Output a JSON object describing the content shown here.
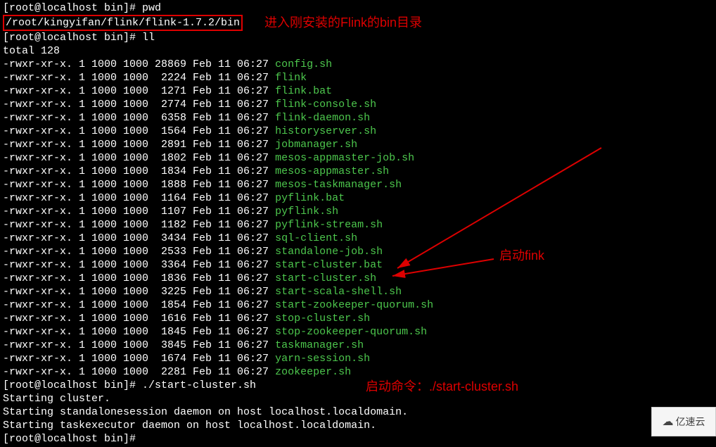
{
  "prompt1": "[root@localhost bin]# pwd",
  "path": "/root/kingyifan/flink/flink-1.7.2/bin",
  "prompt2": "[root@localhost bin]# ll",
  "total": "total 128",
  "perm": "-rwxr-xr-x.",
  "link": "1",
  "own": "1000",
  "grp": "1000",
  "date_prefix": "Feb 11 06:27",
  "files": [
    {
      "size": "28869",
      "name": "config.sh"
    },
    {
      "size": " 2224",
      "name": "flink"
    },
    {
      "size": " 1271",
      "name": "flink.bat"
    },
    {
      "size": " 2774",
      "name": "flink-console.sh"
    },
    {
      "size": " 6358",
      "name": "flink-daemon.sh"
    },
    {
      "size": " 1564",
      "name": "historyserver.sh"
    },
    {
      "size": " 2891",
      "name": "jobmanager.sh"
    },
    {
      "size": " 1802",
      "name": "mesos-appmaster-job.sh"
    },
    {
      "size": " 1834",
      "name": "mesos-appmaster.sh"
    },
    {
      "size": " 1888",
      "name": "mesos-taskmanager.sh"
    },
    {
      "size": " 1164",
      "name": "pyflink.bat"
    },
    {
      "size": " 1107",
      "name": "pyflink.sh"
    },
    {
      "size": " 1182",
      "name": "pyflink-stream.sh"
    },
    {
      "size": " 3434",
      "name": "sql-client.sh"
    },
    {
      "size": " 2533",
      "name": "standalone-job.sh"
    },
    {
      "size": " 3364",
      "name": "start-cluster.bat"
    },
    {
      "size": " 1836",
      "name": "start-cluster.sh"
    },
    {
      "size": " 3225",
      "name": "start-scala-shell.sh"
    },
    {
      "size": " 1854",
      "name": "start-zookeeper-quorum.sh"
    },
    {
      "size": " 1616",
      "name": "stop-cluster.sh"
    },
    {
      "size": " 1845",
      "name": "stop-zookeeper-quorum.sh"
    },
    {
      "size": " 3845",
      "name": "taskmanager.sh"
    },
    {
      "size": " 1674",
      "name": "yarn-session.sh"
    },
    {
      "size": " 2281",
      "name": "zookeeper.sh"
    }
  ],
  "prompt3": "[root@localhost bin]# ./start-cluster.sh",
  "out_lines": [
    "Starting cluster.",
    "Starting standalonesession daemon on host localhost.localdomain.",
    "Starting taskexecutor daemon on host localhost.localdomain."
  ],
  "prompt4": "[root@localhost bin]# ",
  "annotations": {
    "a1": "进入刚安装的Flink的bin目录",
    "a2": "启动fink",
    "a3": "启动命令：./start-cluster.sh"
  },
  "logo": "亿速云"
}
